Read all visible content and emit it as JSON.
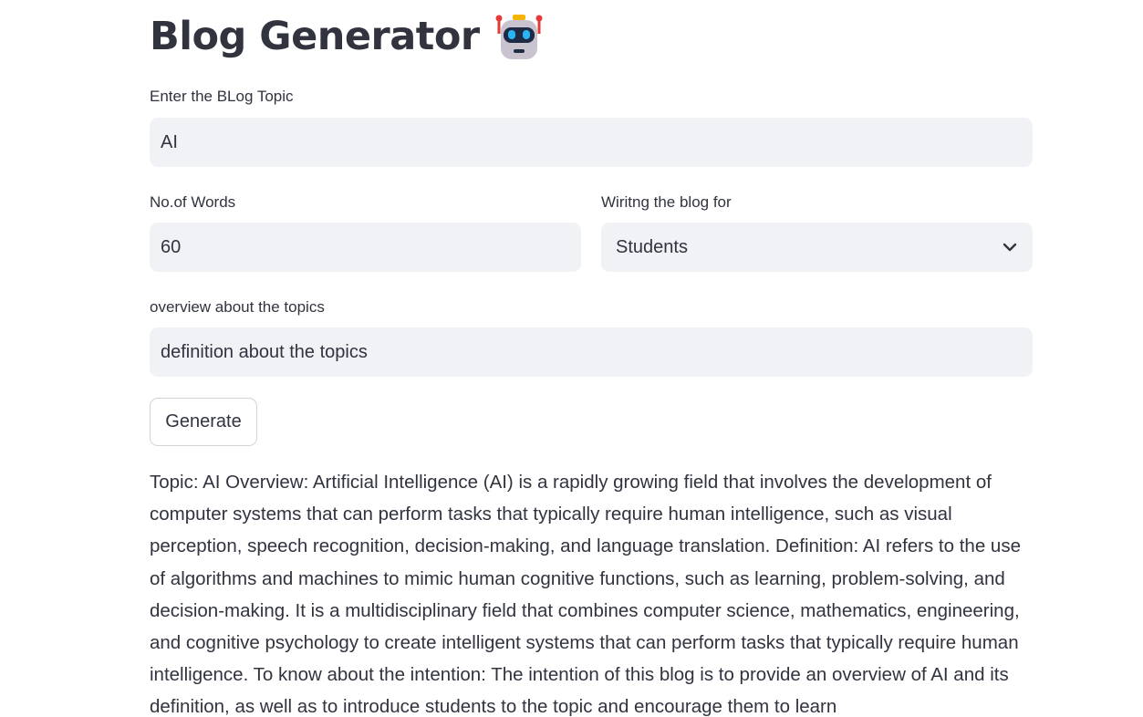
{
  "header": {
    "title": "Blog Generator",
    "emoji_icon": "robot-face-icon"
  },
  "topic_field": {
    "label": "Enter the BLog Topic",
    "value": "AI"
  },
  "words_field": {
    "label": "No.of Words",
    "value": "60"
  },
  "audience_field": {
    "label": "Wiritng the blog for",
    "selected": "Students",
    "icon": "chevron-down-icon"
  },
  "overview_field": {
    "label": "overview about the topics",
    "value": "definition about the topics"
  },
  "actions": {
    "generate_label": "Generate"
  },
  "output": {
    "text": "Topic: AI Overview: Artificial Intelligence (AI) is a rapidly growing field that involves the development of computer systems that can perform tasks that typically require human intelligence, such as visual perception, speech recognition, decision-making, and language translation. Definition: AI refers to the use of algorithms and machines to mimic human cognitive functions, such as learning, problem-solving, and decision-making. It is a multidisciplinary field that combines computer science, mathematics, engineering, and cognitive psychology to create intelligent systems that can perform tasks that typically require human intelligence. To know about the intention: The intention of this blog is to provide an overview of AI and its definition, as well as to introduce students to the topic and encourage them to learn"
  },
  "colors": {
    "text": "#31333f",
    "input_bg": "#f0f2f6",
    "button_border": "#d3d4d9",
    "robot_head": "#c9c3cf",
    "robot_visor": "#1f2a44",
    "robot_eyes": "#29b6f6",
    "robot_antenna": "#e53935",
    "robot_top": "#f4b400"
  }
}
